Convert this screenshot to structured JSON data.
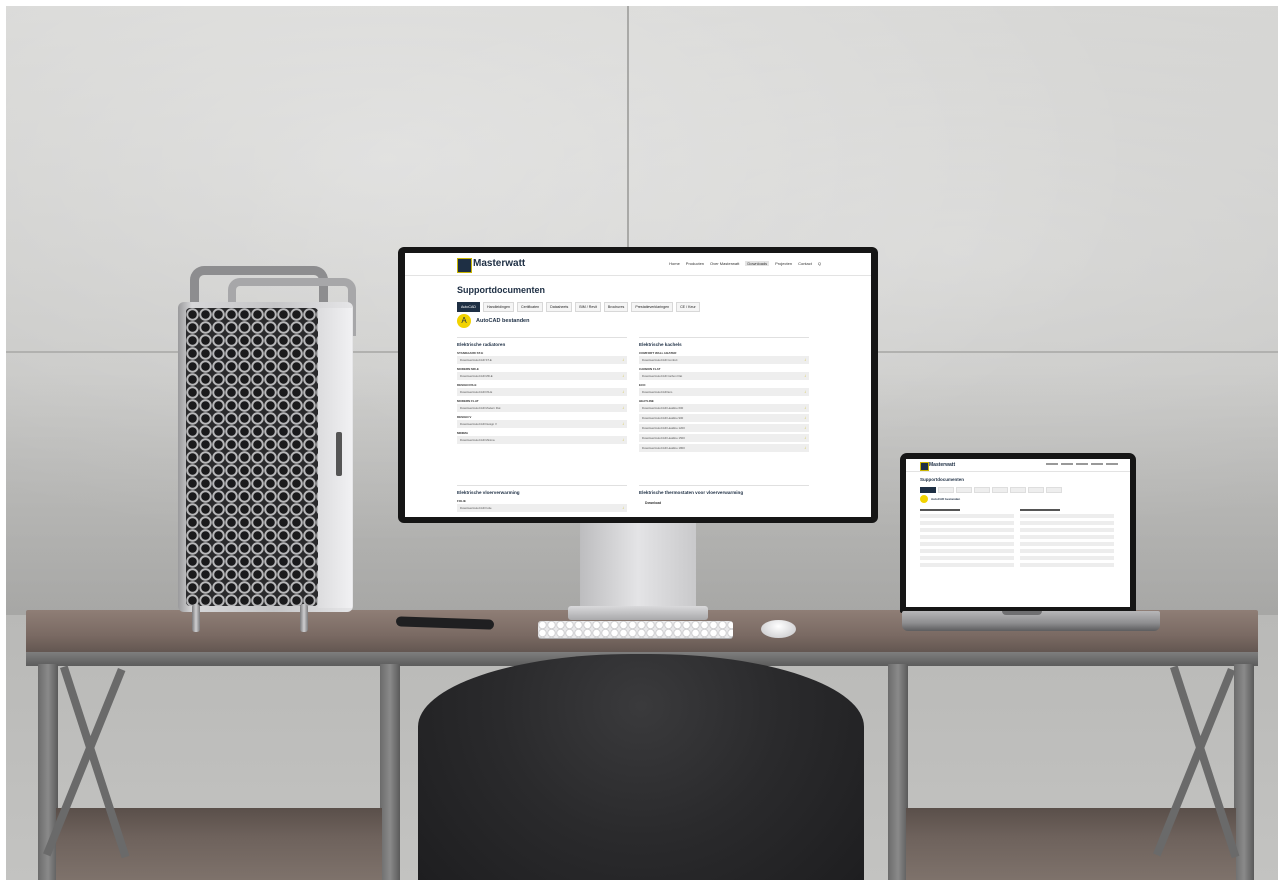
{
  "monitor_site": {
    "brand": "Masterwatt",
    "nav": [
      "Home",
      "Producten",
      "Over Masterwatt",
      "Downloads",
      "Projecten",
      "Contact",
      "Q"
    ],
    "active_nav_index": 3,
    "page_title": "Supportdocumenten",
    "tabs": [
      "AutoCAD",
      "Handleidingen",
      "Certificaten",
      "Datasheets",
      "BIM / Revit",
      "Brochures",
      "Prestatieverklaringen",
      "CE / Keur"
    ],
    "selected_tab_index": 0,
    "autocad_label": "AutoCAD bestanden",
    "left_panel": {
      "title": "Elektrische radiatoren",
      "groups": [
        {
          "label": "STANDAARD ST-E",
          "files": [
            "Download AutoCAD ST-E"
          ]
        },
        {
          "label": "MODERN MD-E",
          "files": [
            "Download AutoCAD MD-E"
          ]
        },
        {
          "label": "DESIGN DS-E",
          "files": [
            "Download AutoCAD DS-E"
          ]
        },
        {
          "label": "MODERN FLAT",
          "files": [
            "Download AutoCAD Modern Flat"
          ]
        },
        {
          "label": "DESIGN V",
          "files": [
            "Download AutoCAD Design V"
          ]
        },
        {
          "label": "MINIMA",
          "files": [
            "Download AutoCAD Minima"
          ]
        }
      ]
    },
    "right_panel": {
      "title": "Elektrische kachels",
      "groups": [
        {
          "label": "COMFORT WALL HEATER",
          "files": [
            "Download AutoCAD Comfort"
          ]
        },
        {
          "label": "CARBON FLAT",
          "files": [
            "Download AutoCAD Carbon Flat"
          ]
        },
        {
          "label": "ECO",
          "files": [
            "Download AutoCAD Eco"
          ]
        },
        {
          "label": "HEATLINE",
          "files": [
            "Download AutoCAD Heatline 600",
            "Download AutoCAD Heatline 900",
            "Download AutoCAD Heatline 1200",
            "Download AutoCAD Heatline 1500",
            "Download AutoCAD Heatline 1800"
          ]
        }
      ]
    },
    "bottom_left": {
      "title": "Elektrische vloerverwarming",
      "group_label": "FOLIE",
      "file": "Download AutoCAD Folie"
    },
    "bottom_right": {
      "title": "Elektrische thermostaten voor vloerverwarming",
      "label": "Download"
    }
  },
  "laptop_site": {
    "brand": "Masterwatt",
    "page_title": "Supportdocumenten",
    "autocad_label": "AutoCAD bestanden"
  },
  "colors": {
    "brand_navy": "#1e2f44",
    "brand_yellow": "#f2d300"
  },
  "icons": {
    "download": "↓",
    "autocad": "A"
  }
}
